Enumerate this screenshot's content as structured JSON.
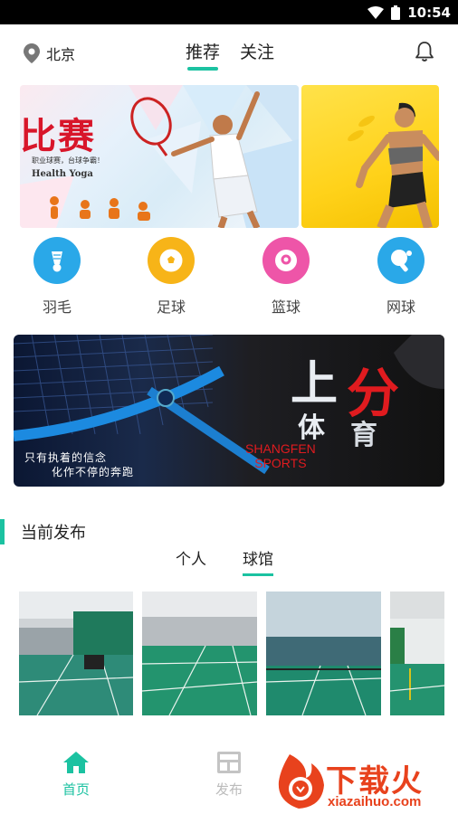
{
  "status_bar": {
    "time": "10:54"
  },
  "header": {
    "location": "北京",
    "tabs": [
      {
        "label": "推荐",
        "active": true
      },
      {
        "label": "关注",
        "active": false
      }
    ]
  },
  "banners": [
    {
      "title": "比赛",
      "subtitle": "职业球赛，台球争霸！",
      "caption": "Health Yoga"
    },
    {
      "description": "woman running"
    }
  ],
  "categories": [
    {
      "label": "羽毛",
      "icon": "shuttlecock-icon",
      "color": "#2aa8e8"
    },
    {
      "label": "足球",
      "icon": "football-icon",
      "color": "#f7b418"
    },
    {
      "label": "篮球",
      "icon": "billiard-ball-icon",
      "color": "#ee55a8"
    },
    {
      "label": "网球",
      "icon": "ping-pong-icon",
      "color": "#2aa8e8"
    }
  ],
  "promo": {
    "title_1": "上",
    "title_2": "分",
    "title_3": "体",
    "title_4": "育",
    "english_1": "SHANGFEN",
    "english_2": "SPORTS",
    "slogan_1": "只有执着的信念",
    "slogan_2": "化作不停的奔跑"
  },
  "section": {
    "title": "当前发布",
    "subtabs": [
      {
        "label": "个人",
        "active": false
      },
      {
        "label": "球馆",
        "active": true
      }
    ]
  },
  "bottom_nav": [
    {
      "label": "首页",
      "icon": "home-icon",
      "active": true
    },
    {
      "label": "发布",
      "icon": "publish-icon",
      "active": false
    }
  ],
  "watermark": {
    "text": "下载火",
    "url": "xiazaihuo.com"
  },
  "colors": {
    "accent": "#1bc2a1",
    "inactive": "#bbbbbb"
  }
}
